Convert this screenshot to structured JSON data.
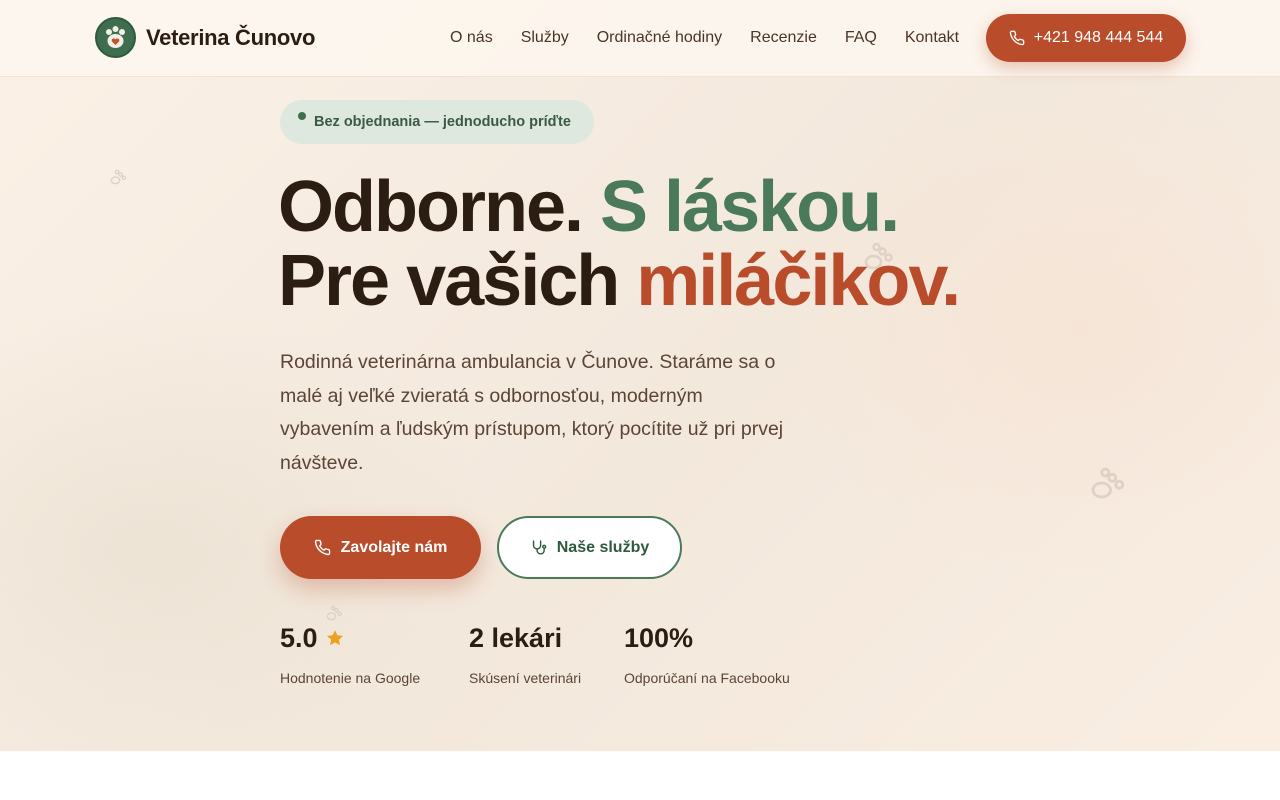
{
  "brand": {
    "name": "Veterina Čunovo"
  },
  "nav": {
    "items": [
      {
        "label": "O nás"
      },
      {
        "label": "Služby"
      },
      {
        "label": "Ordinačné hodiny"
      },
      {
        "label": "Recenzie"
      },
      {
        "label": "FAQ"
      },
      {
        "label": "Kontakt"
      }
    ],
    "phone_label": "+421 948 444 544"
  },
  "hero": {
    "badge": "Bez objednania — jednoducho príďte",
    "headline": {
      "line1_a": "Odborne.",
      "line1_b": "S láskou.",
      "line2_a": "Pre vašich",
      "line2_b": "miláčikov."
    },
    "lead": "Rodinná veterinárna ambulancia v Čunove. Staráme sa o malé aj veľké zvieratá s odbornosťou, moderným vybavením a ľudským prístupom, ktorý pocítite už pri prvej návšteve.",
    "cta_primary": "Zavolajte nám",
    "cta_secondary": "Naše služby"
  },
  "stats": [
    {
      "value": "5.0",
      "label": "Hodnotenie na Google"
    },
    {
      "value": "2 lekári",
      "label": "Skúsení veterinári"
    },
    {
      "value": "100%",
      "label": "Odporúčaní na Facebooku"
    }
  ],
  "colors": {
    "primary": "#b84c2b",
    "green": "#4a7a5a",
    "dark_text": "#2b1d12",
    "background": "#fbf1e6",
    "star": "#f0a020"
  },
  "icons": {
    "logo": "paw-heart-icon",
    "phone": "phone-icon",
    "stethoscope": "stethoscope-icon",
    "star": "star-icon",
    "paw_decoration": "paw-icon"
  }
}
